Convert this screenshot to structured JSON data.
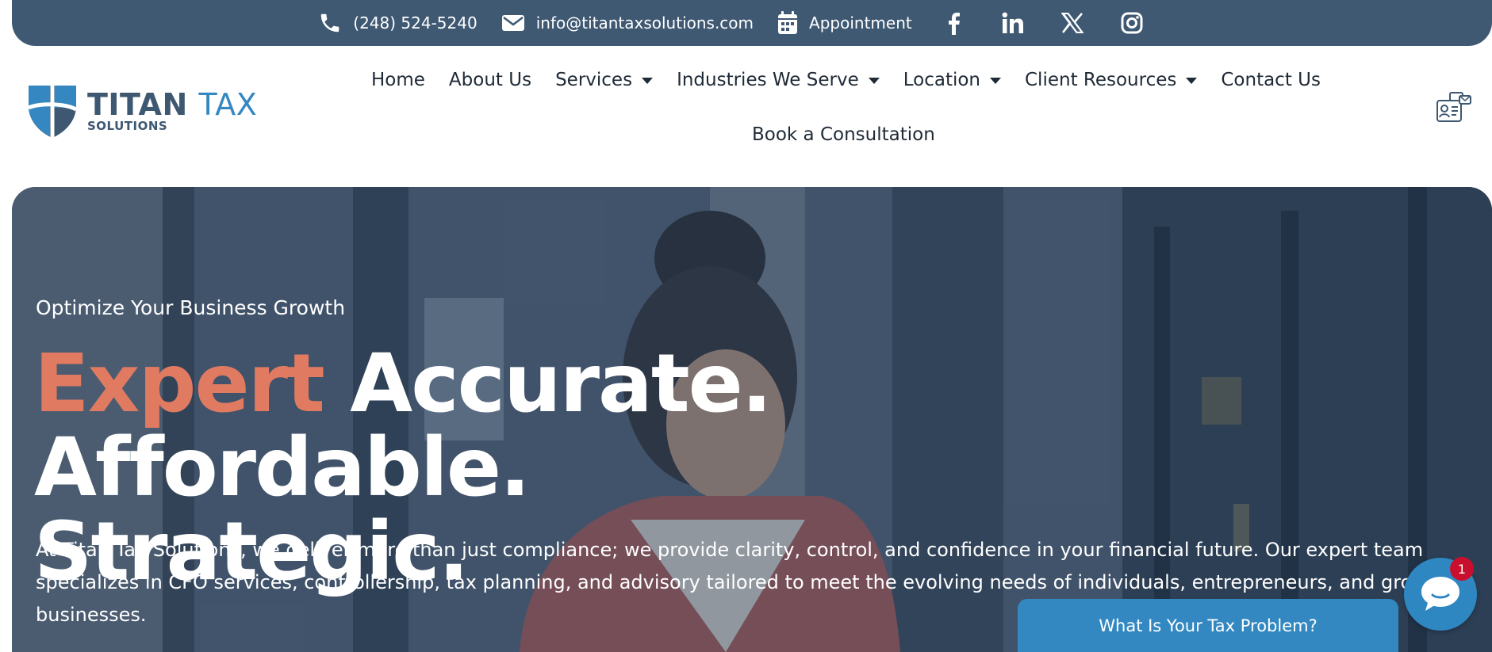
{
  "topbar": {
    "phone": "(248) 524-5240",
    "email": "info@titantaxsolutions.com",
    "appointment": "Appointment",
    "social": [
      "facebook-icon",
      "linkedin-icon",
      "x-icon",
      "instagram-icon"
    ]
  },
  "logo": {
    "word1": "TITAN",
    "word2": "TAX",
    "sub": "SOLUTIONS"
  },
  "nav": {
    "items": [
      {
        "label": "Home",
        "dropdown": false
      },
      {
        "label": "About Us",
        "dropdown": false
      },
      {
        "label": "Services",
        "dropdown": true
      },
      {
        "label": "Industries We Serve",
        "dropdown": true
      },
      {
        "label": "Location",
        "dropdown": true
      },
      {
        "label": "Client Resources",
        "dropdown": true
      },
      {
        "label": "Contact Us",
        "dropdown": false
      }
    ],
    "second_row": "Book a Consultation"
  },
  "hero": {
    "eyebrow": "Optimize Your Business Growth",
    "headline_accent": "Expert",
    "headline_rest": "Accurate. Affordable.",
    "headline_line2": "Strategic.",
    "description": "At Titan Tax Solutions, we deliver more than just compliance; we provide clarity, control, and confidence in your financial future. Our expert team specializes in CFO services, controllership, tax planning, and advisory tailored to meet the evolving needs of individuals, entrepreneurs, and growing businesses."
  },
  "chat": {
    "bar_label": "What Is Your Tax Problem?",
    "badge": "1"
  },
  "colors": {
    "topbar": "#3f5973",
    "accent": "#e07b62",
    "brand_blue": "#3487c0",
    "chat": "#3388c1"
  }
}
